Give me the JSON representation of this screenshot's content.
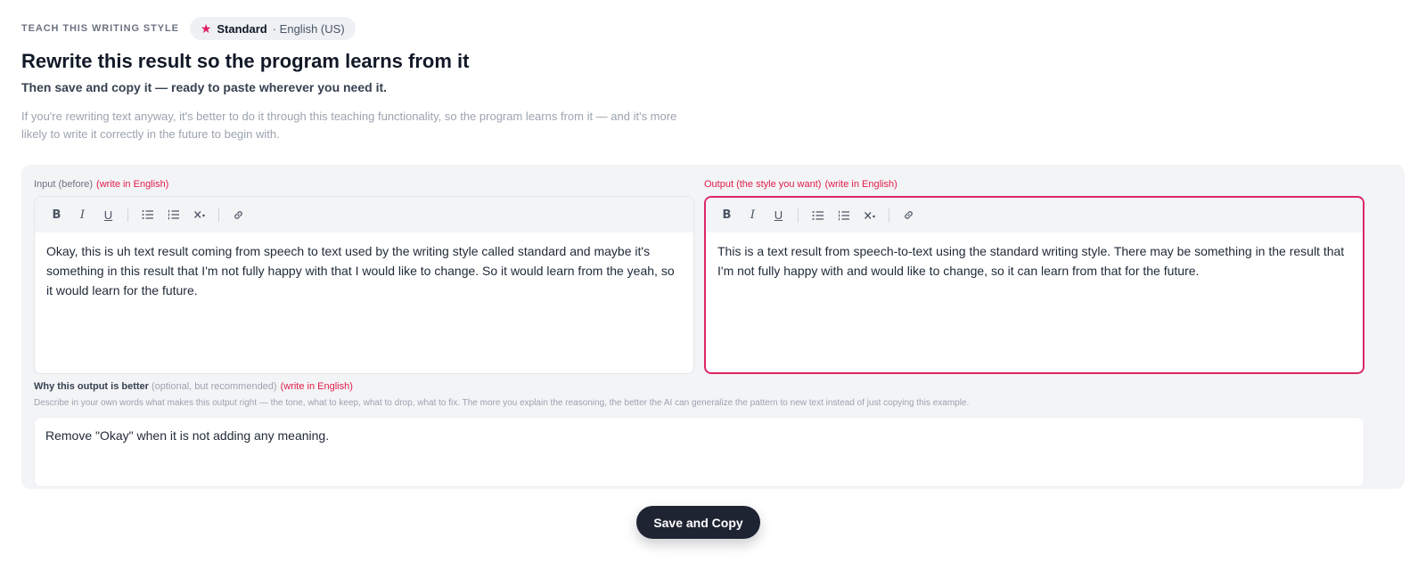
{
  "header": {
    "eyebrow": "TEACH THIS WRITING STYLE",
    "style_name": "Standard",
    "style_lang": "· English (US)",
    "title": "Rewrite this result so the program learns from it",
    "subtitle": "Then save and copy it — ready to paste wherever you need it.",
    "description": "If you're rewriting text anyway, it's better to do it through this teaching functionality, so the program learns from it — and it's more likely to write it correctly in the future to begin with."
  },
  "input_editor": {
    "label": "Input (before)",
    "lang_note": "(write in English)",
    "text": "Okay, this is uh text result coming from speech to text used by the writing style called standard and maybe it's something in this result that I'm not fully happy with that I would like to change. So it would learn from the yeah, so it would learn for the future."
  },
  "output_editor": {
    "label": "Output (the style you want)",
    "lang_note": "(write in English)",
    "text": "This is a text result from speech-to-text using the standard writing style. There may be something in the result that I'm not fully happy with and would like to change, so it can learn from that for the future."
  },
  "toolbar": {
    "bold": "B",
    "italic": "I",
    "underline": "U",
    "icons": [
      "bold-icon",
      "italic-icon",
      "underline-icon",
      "bullet-list-icon",
      "numbered-list-icon",
      "clear-format-icon",
      "link-icon"
    ]
  },
  "why": {
    "label": "Why this output is better",
    "optional": "(optional, but recommended)",
    "lang_note": "(write in English)",
    "help": "Describe in your own words what makes this output right — the tone, what to keep, what to drop, what to fix. The more you explain the reasoning, the better the AI can generalize the pattern to new text instead of just copying this example.",
    "value": "Remove \"Okay\" when it is not adding any meaning."
  },
  "actions": {
    "save_label": "Save and Copy"
  },
  "colors": {
    "accent": "#db2767",
    "button_bg": "#1f2433",
    "card_bg": "#f3f4f6"
  }
}
